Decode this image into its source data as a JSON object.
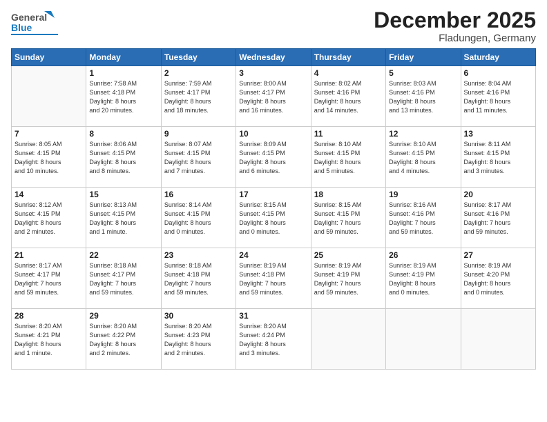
{
  "header": {
    "logo_general": "General",
    "logo_blue": "Blue",
    "month": "December 2025",
    "location": "Fladungen, Germany"
  },
  "days_of_week": [
    "Sunday",
    "Monday",
    "Tuesday",
    "Wednesday",
    "Thursday",
    "Friday",
    "Saturday"
  ],
  "weeks": [
    [
      {
        "day": "",
        "lines": []
      },
      {
        "day": "1",
        "lines": [
          "Sunrise: 7:58 AM",
          "Sunset: 4:18 PM",
          "Daylight: 8 hours",
          "and 20 minutes."
        ]
      },
      {
        "day": "2",
        "lines": [
          "Sunrise: 7:59 AM",
          "Sunset: 4:17 PM",
          "Daylight: 8 hours",
          "and 18 minutes."
        ]
      },
      {
        "day": "3",
        "lines": [
          "Sunrise: 8:00 AM",
          "Sunset: 4:17 PM",
          "Daylight: 8 hours",
          "and 16 minutes."
        ]
      },
      {
        "day": "4",
        "lines": [
          "Sunrise: 8:02 AM",
          "Sunset: 4:16 PM",
          "Daylight: 8 hours",
          "and 14 minutes."
        ]
      },
      {
        "day": "5",
        "lines": [
          "Sunrise: 8:03 AM",
          "Sunset: 4:16 PM",
          "Daylight: 8 hours",
          "and 13 minutes."
        ]
      },
      {
        "day": "6",
        "lines": [
          "Sunrise: 8:04 AM",
          "Sunset: 4:16 PM",
          "Daylight: 8 hours",
          "and 11 minutes."
        ]
      }
    ],
    [
      {
        "day": "7",
        "lines": [
          "Sunrise: 8:05 AM",
          "Sunset: 4:15 PM",
          "Daylight: 8 hours",
          "and 10 minutes."
        ]
      },
      {
        "day": "8",
        "lines": [
          "Sunrise: 8:06 AM",
          "Sunset: 4:15 PM",
          "Daylight: 8 hours",
          "and 8 minutes."
        ]
      },
      {
        "day": "9",
        "lines": [
          "Sunrise: 8:07 AM",
          "Sunset: 4:15 PM",
          "Daylight: 8 hours",
          "and 7 minutes."
        ]
      },
      {
        "day": "10",
        "lines": [
          "Sunrise: 8:09 AM",
          "Sunset: 4:15 PM",
          "Daylight: 8 hours",
          "and 6 minutes."
        ]
      },
      {
        "day": "11",
        "lines": [
          "Sunrise: 8:10 AM",
          "Sunset: 4:15 PM",
          "Daylight: 8 hours",
          "and 5 minutes."
        ]
      },
      {
        "day": "12",
        "lines": [
          "Sunrise: 8:10 AM",
          "Sunset: 4:15 PM",
          "Daylight: 8 hours",
          "and 4 minutes."
        ]
      },
      {
        "day": "13",
        "lines": [
          "Sunrise: 8:11 AM",
          "Sunset: 4:15 PM",
          "Daylight: 8 hours",
          "and 3 minutes."
        ]
      }
    ],
    [
      {
        "day": "14",
        "lines": [
          "Sunrise: 8:12 AM",
          "Sunset: 4:15 PM",
          "Daylight: 8 hours",
          "and 2 minutes."
        ]
      },
      {
        "day": "15",
        "lines": [
          "Sunrise: 8:13 AM",
          "Sunset: 4:15 PM",
          "Daylight: 8 hours",
          "and 1 minute."
        ]
      },
      {
        "day": "16",
        "lines": [
          "Sunrise: 8:14 AM",
          "Sunset: 4:15 PM",
          "Daylight: 8 hours",
          "and 0 minutes."
        ]
      },
      {
        "day": "17",
        "lines": [
          "Sunrise: 8:15 AM",
          "Sunset: 4:15 PM",
          "Daylight: 8 hours",
          "and 0 minutes."
        ]
      },
      {
        "day": "18",
        "lines": [
          "Sunrise: 8:15 AM",
          "Sunset: 4:15 PM",
          "Daylight: 7 hours",
          "and 59 minutes."
        ]
      },
      {
        "day": "19",
        "lines": [
          "Sunrise: 8:16 AM",
          "Sunset: 4:16 PM",
          "Daylight: 7 hours",
          "and 59 minutes."
        ]
      },
      {
        "day": "20",
        "lines": [
          "Sunrise: 8:17 AM",
          "Sunset: 4:16 PM",
          "Daylight: 7 hours",
          "and 59 minutes."
        ]
      }
    ],
    [
      {
        "day": "21",
        "lines": [
          "Sunrise: 8:17 AM",
          "Sunset: 4:17 PM",
          "Daylight: 7 hours",
          "and 59 minutes."
        ]
      },
      {
        "day": "22",
        "lines": [
          "Sunrise: 8:18 AM",
          "Sunset: 4:17 PM",
          "Daylight: 7 hours",
          "and 59 minutes."
        ]
      },
      {
        "day": "23",
        "lines": [
          "Sunrise: 8:18 AM",
          "Sunset: 4:18 PM",
          "Daylight: 7 hours",
          "and 59 minutes."
        ]
      },
      {
        "day": "24",
        "lines": [
          "Sunrise: 8:19 AM",
          "Sunset: 4:18 PM",
          "Daylight: 7 hours",
          "and 59 minutes."
        ]
      },
      {
        "day": "25",
        "lines": [
          "Sunrise: 8:19 AM",
          "Sunset: 4:19 PM",
          "Daylight: 7 hours",
          "and 59 minutes."
        ]
      },
      {
        "day": "26",
        "lines": [
          "Sunrise: 8:19 AM",
          "Sunset: 4:19 PM",
          "Daylight: 8 hours",
          "and 0 minutes."
        ]
      },
      {
        "day": "27",
        "lines": [
          "Sunrise: 8:19 AM",
          "Sunset: 4:20 PM",
          "Daylight: 8 hours",
          "and 0 minutes."
        ]
      }
    ],
    [
      {
        "day": "28",
        "lines": [
          "Sunrise: 8:20 AM",
          "Sunset: 4:21 PM",
          "Daylight: 8 hours",
          "and 1 minute."
        ]
      },
      {
        "day": "29",
        "lines": [
          "Sunrise: 8:20 AM",
          "Sunset: 4:22 PM",
          "Daylight: 8 hours",
          "and 2 minutes."
        ]
      },
      {
        "day": "30",
        "lines": [
          "Sunrise: 8:20 AM",
          "Sunset: 4:23 PM",
          "Daylight: 8 hours",
          "and 2 minutes."
        ]
      },
      {
        "day": "31",
        "lines": [
          "Sunrise: 8:20 AM",
          "Sunset: 4:24 PM",
          "Daylight: 8 hours",
          "and 3 minutes."
        ]
      },
      {
        "day": "",
        "lines": []
      },
      {
        "day": "",
        "lines": []
      },
      {
        "day": "",
        "lines": []
      }
    ]
  ]
}
